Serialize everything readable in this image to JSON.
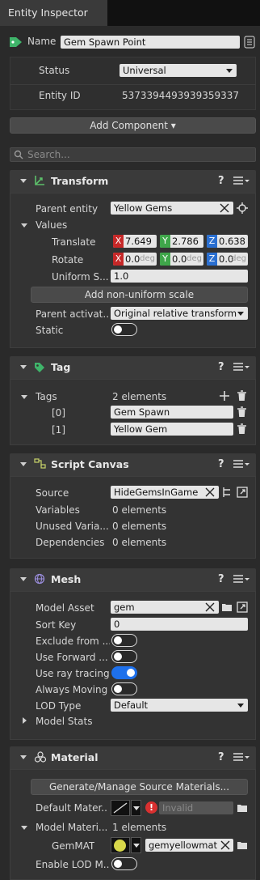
{
  "window": {
    "tab_title": "Entity Inspector"
  },
  "entity": {
    "name_label": "Name",
    "name_value": "Gem Spawn Point",
    "status_label": "Status",
    "status_value": "Universal",
    "id_label": "Entity ID",
    "id_value": "5373394493939359337"
  },
  "toolbar": {
    "add_component": "Add Component ▾",
    "search_placeholder": "Search..."
  },
  "transform": {
    "title": "Transform",
    "parent_label": "Parent entity",
    "parent_value": "Yellow Gems",
    "values_label": "Values",
    "translate_label": "Translate",
    "translate": {
      "x": "7.649",
      "y": "2.786",
      "z": "0.638"
    },
    "rotate_label": "Rotate",
    "rotate": {
      "x": "0.0",
      "y": "0.0",
      "z": "0.0",
      "unit": "deg"
    },
    "uniform_label": "Uniform S...",
    "uniform_value": "1.0",
    "nonuniform_button": "Add non-uniform scale",
    "parent_activation_label": "Parent activat...",
    "parent_activation_value": "Original relative transform",
    "static_label": "Static"
  },
  "tag": {
    "title": "Tag",
    "tags_label": "Tags",
    "tags_count": "2 elements",
    "items": [
      {
        "index": "[0]",
        "value": "Gem Spawn"
      },
      {
        "index": "[1]",
        "value": "Yellow Gem"
      }
    ]
  },
  "script_canvas": {
    "title": "Script Canvas",
    "source_label": "Source",
    "source_value": "HideGemsInGame",
    "variables_label": "Variables",
    "variables_value": "0 elements",
    "unused_label": "Unused Varia...",
    "unused_value": "0 elements",
    "deps_label": "Dependencies",
    "deps_value": "0 elements"
  },
  "mesh": {
    "title": "Mesh",
    "model_label": "Model Asset",
    "model_value": "gem",
    "sort_label": "Sort Key",
    "sort_value": "0",
    "exclude_label": "Exclude from ...",
    "forward_label": "Use Forward ...",
    "raytrace_label": "Use ray tracing",
    "moving_label": "Always Moving",
    "lod_label": "LOD Type",
    "lod_value": "Default",
    "stats_label": "Model Stats",
    "toggles": {
      "exclude": false,
      "forward": false,
      "raytrace": true,
      "moving": false
    }
  },
  "material": {
    "title": "Material",
    "generate_button": "Generate/Manage Source Materials...",
    "default_label": "Default Mater...",
    "default_value": "Invalid",
    "model_label": "Model Materi...",
    "model_count": "1 elements",
    "gem_label": "GemMAT",
    "gem_value": "gemyellowmat",
    "lod_label": "Enable LOD M...",
    "gem_color": "#d8d84a"
  },
  "common": {
    "help": "?"
  },
  "colors": {
    "accent": "#1e70eb",
    "x": "#c62828",
    "y": "#3fa64a",
    "z": "#2a6fd1",
    "tag_green": "#3fb46a"
  }
}
